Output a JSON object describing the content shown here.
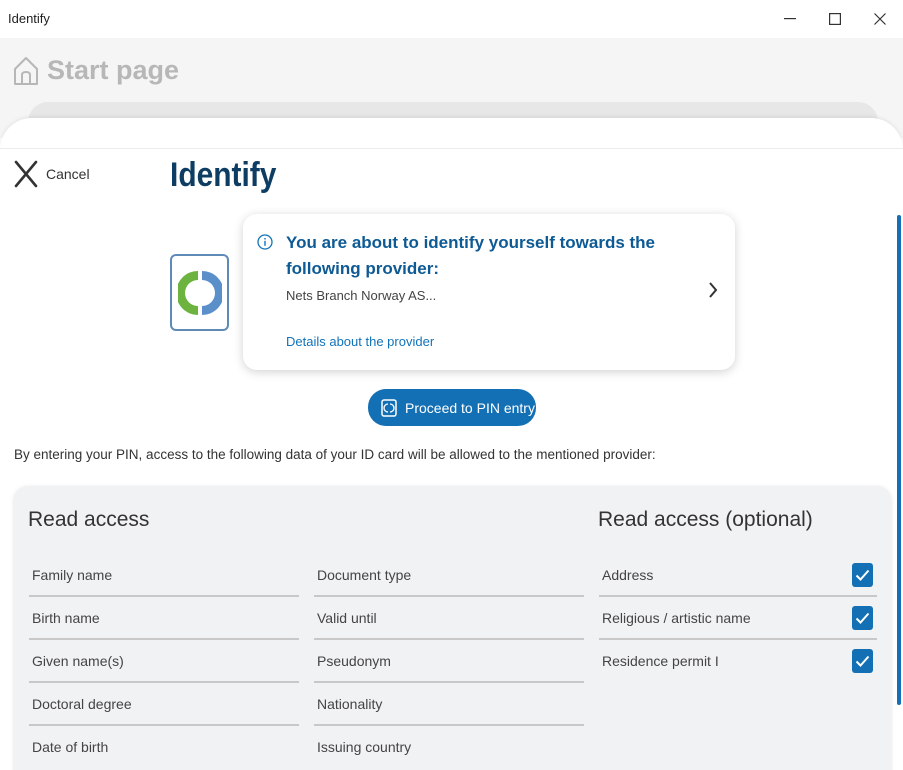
{
  "window": {
    "title": "Identify"
  },
  "background": {
    "start_page_label": "Start page"
  },
  "dialog": {
    "cancel_label": "Cancel",
    "heading": "Identify",
    "provider_card": {
      "message": "You are about to identify yourself towards the following provider:",
      "provider_name": "Nets Branch Norway AS...",
      "details_link": "Details about the provider"
    },
    "proceed_button": "Proceed to PIN entry",
    "intro_text": "By entering your PIN, access to the following data of your ID card will be allowed to the mentioned provider:",
    "read_access": {
      "title": "Read access",
      "column1": [
        "Family name",
        "Birth name",
        "Given name(s)",
        "Doctoral degree",
        "Date of birth"
      ],
      "column2": [
        "Document type",
        "Valid until",
        "Pseudonym",
        "Nationality",
        "Issuing country"
      ]
    },
    "read_access_optional": {
      "title": "Read access (optional)",
      "items": [
        {
          "label": "Address",
          "checked": true
        },
        {
          "label": "Religious / artistic name",
          "checked": true
        },
        {
          "label": "Residence permit I",
          "checked": true
        }
      ]
    }
  },
  "colors": {
    "accent": "#1470b4",
    "heading": "#0e3d63",
    "card_text": "#0e5a94"
  }
}
